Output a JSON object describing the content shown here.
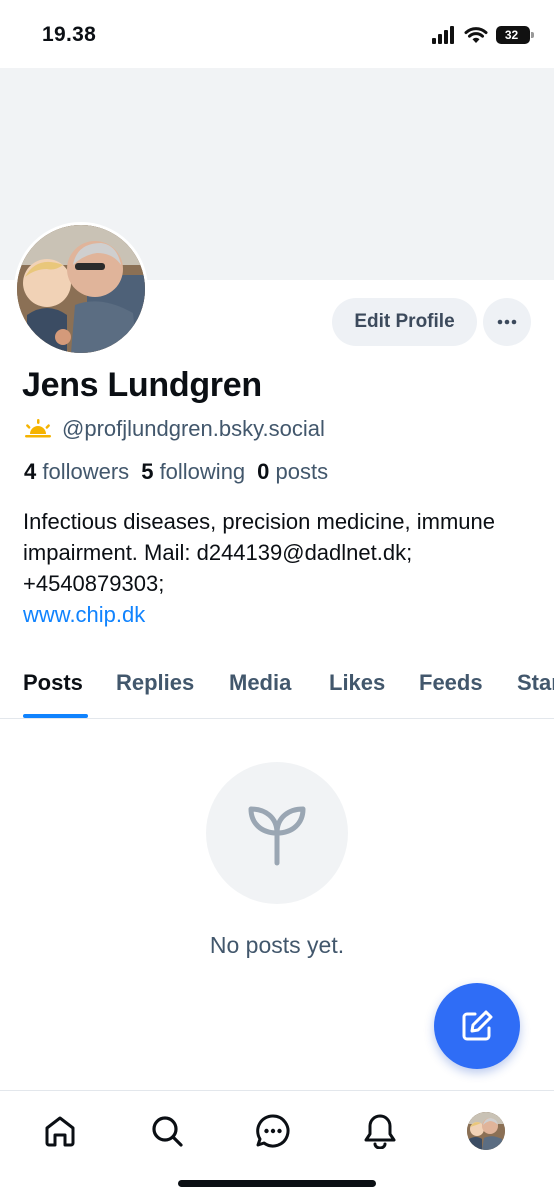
{
  "status_bar": {
    "time": "19.38",
    "battery": "32",
    "icons": [
      "signal-icon",
      "wifi-icon",
      "battery-icon"
    ]
  },
  "profile": {
    "name": "Jens Lundgren",
    "handle": "@profjlundgren.bsky.social",
    "handle_icon": "sun-icon",
    "followers_count": "4",
    "followers_label": "followers",
    "following_count": "5",
    "following_label": "following",
    "posts_count": "0",
    "posts_label": "posts",
    "bio_text": "Infectious diseases, precision medicine, immune impairment. Mail: d244139@dadlnet.dk; +4540879303;",
    "bio_link": "www.chip.dk"
  },
  "actions": {
    "edit_profile": "Edit Profile",
    "more_icon": "ellipsis-icon"
  },
  "tabs": [
    {
      "label": "Posts",
      "active": true
    },
    {
      "label": "Replies",
      "active": false
    },
    {
      "label": "Media",
      "active": false
    },
    {
      "label": "Likes",
      "active": false
    },
    {
      "label": "Feeds",
      "active": false
    },
    {
      "label": "Starter Packs",
      "active": false
    }
  ],
  "empty_state": {
    "icon": "seedling-icon",
    "text": "No posts yet."
  },
  "fab": {
    "icon": "compose-icon"
  },
  "bottom_nav": [
    "home-icon",
    "search-icon",
    "chat-icon",
    "bell-icon",
    "profile-avatar"
  ],
  "colors": {
    "accent": "#1083fe",
    "fab": "#2f6df6",
    "muted_text": "#42576c",
    "surface": "#f1f3f5",
    "sun_icon": "#f5b300"
  }
}
